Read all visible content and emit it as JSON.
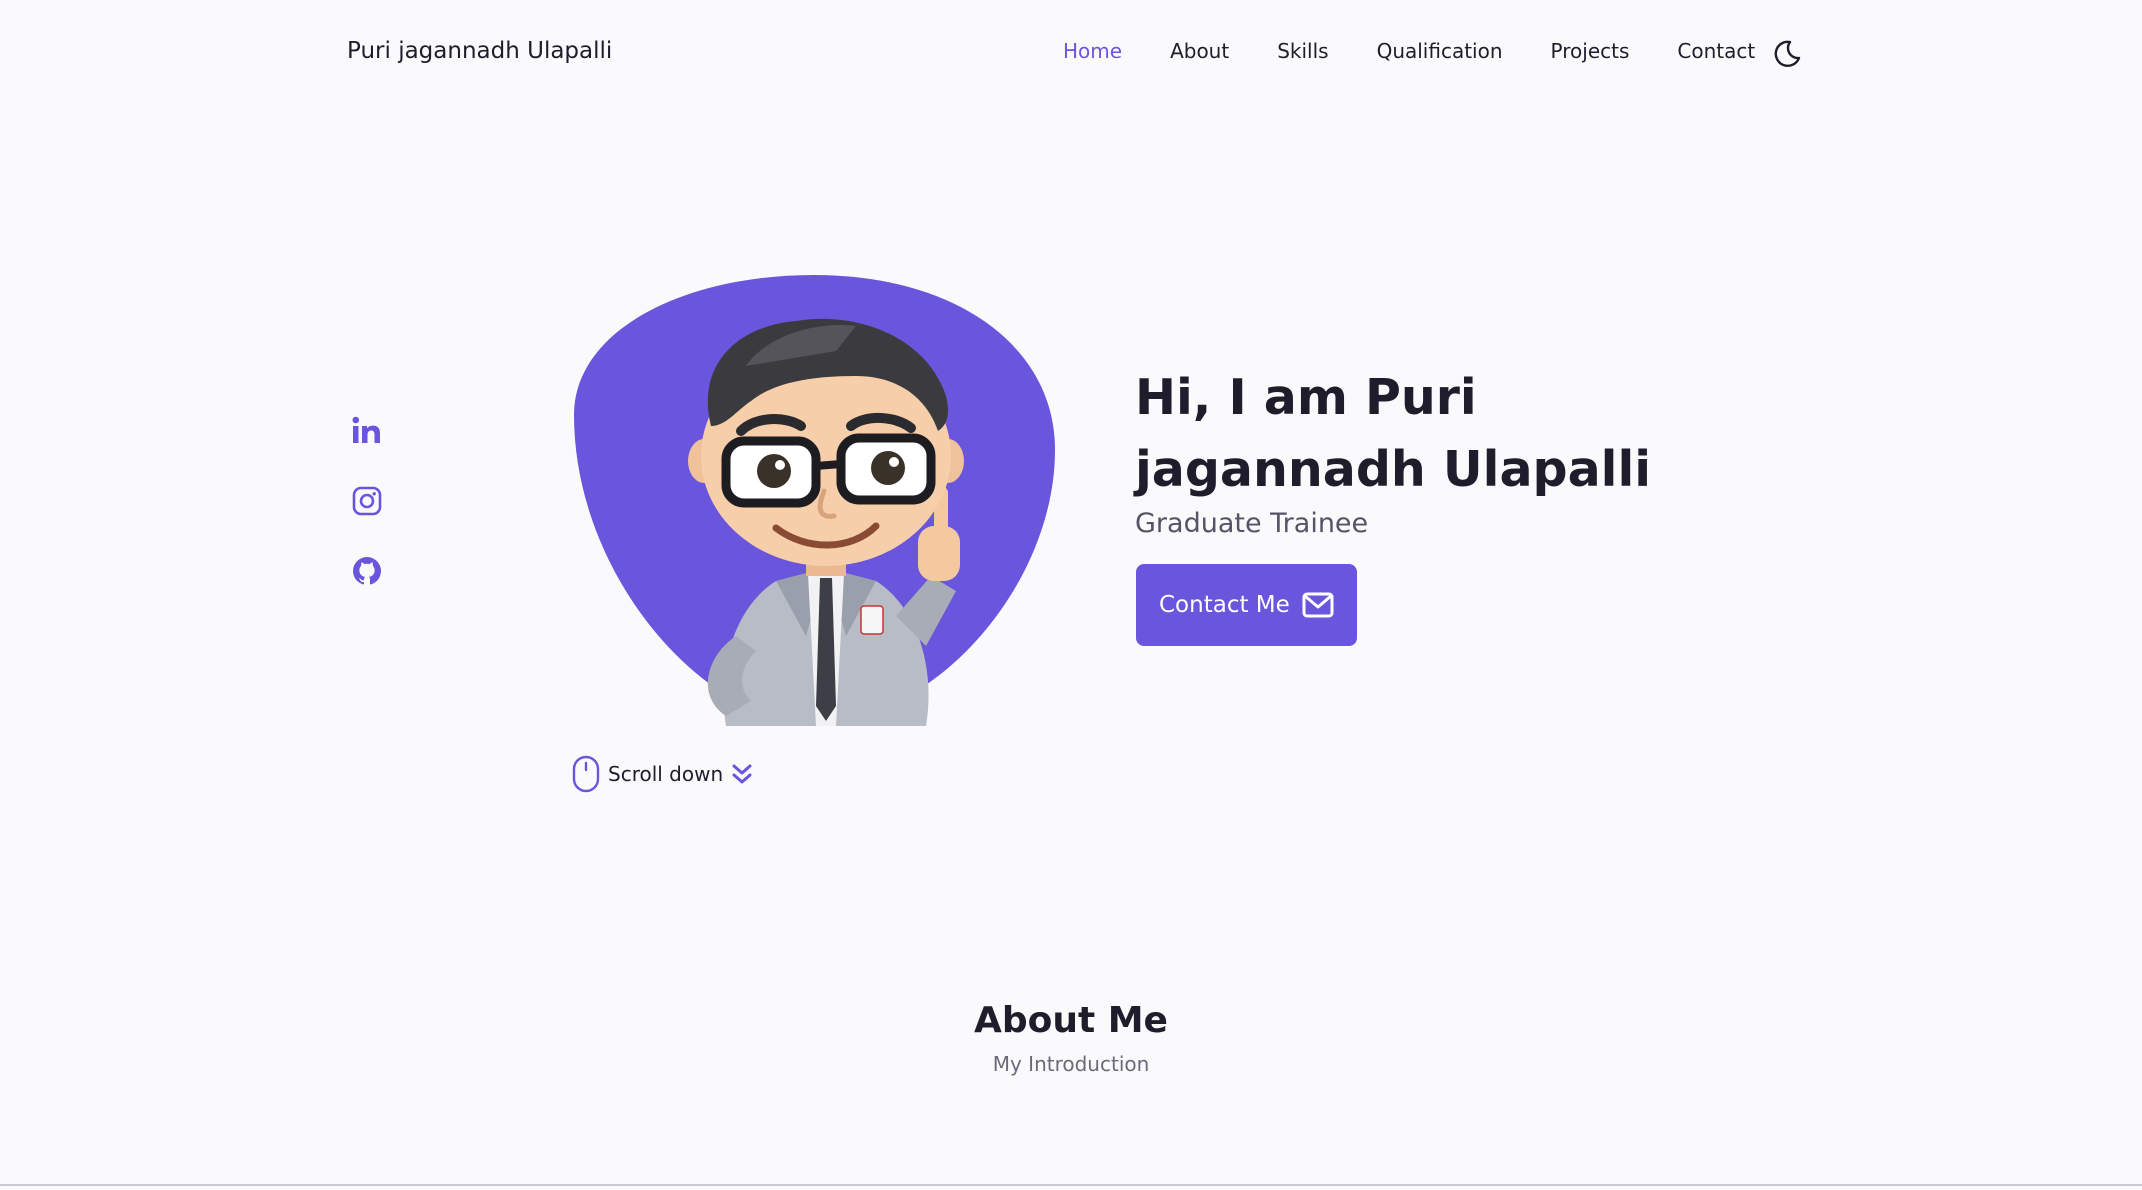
{
  "header": {
    "logo": "Puri jagannadh Ulapalli",
    "nav": [
      "Home",
      "About",
      "Skills",
      "Qualification",
      "Projects",
      "Contact"
    ],
    "active_nav": "Home",
    "theme_icon": "moon-icon"
  },
  "socials": [
    {
      "name": "linkedin-icon"
    },
    {
      "name": "instagram-icon"
    },
    {
      "name": "github-icon"
    }
  ],
  "hero": {
    "title": "Hi, I am Puri jagannadh Ulapalli",
    "subtitle": "Graduate Trainee",
    "contact_button": "Contact Me",
    "scroll_label": "Scroll down"
  },
  "about": {
    "title": "About Me",
    "subtitle": "My Introduction"
  },
  "colors": {
    "accent": "#6a55dd",
    "background": "#fafafd",
    "text": "#1f1d2b"
  }
}
